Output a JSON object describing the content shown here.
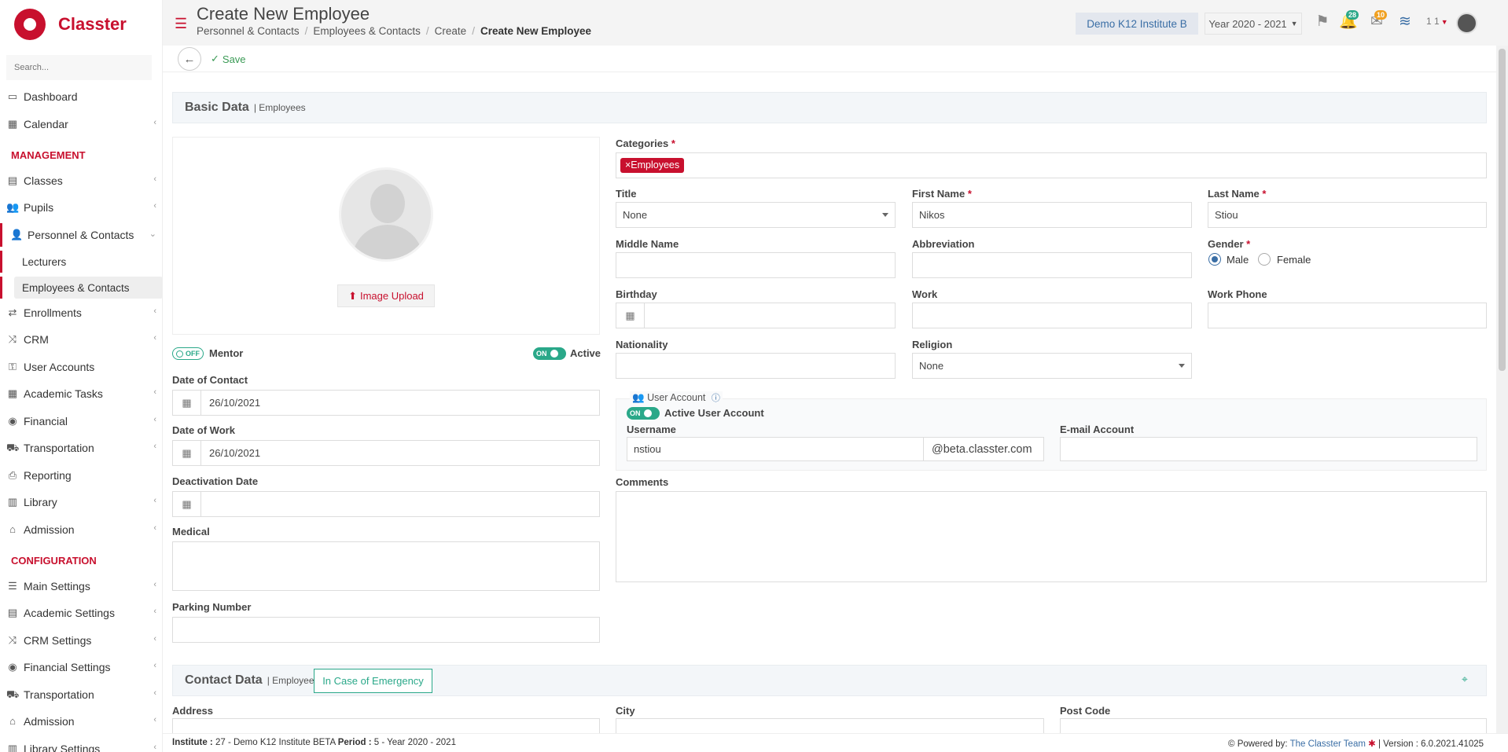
{
  "app": {
    "brand": "Classter",
    "brand_color": "#c8102e"
  },
  "sidebar": {
    "search_placeholder": "Search...",
    "items": [
      {
        "label": "Dashboard",
        "icon": "laptop-icon"
      },
      {
        "label": "Calendar",
        "icon": "calendar-icon"
      },
      {
        "label": "Classes",
        "icon": "classes-icon"
      },
      {
        "label": "Pupils",
        "icon": "pupils-icon"
      },
      {
        "label": "Personnel & Contacts",
        "icon": "person-icon"
      },
      {
        "label": "Enrollments",
        "icon": "exchange-icon"
      },
      {
        "label": "CRM",
        "icon": "shuffle-icon"
      },
      {
        "label": "User Accounts",
        "icon": "key-icon"
      },
      {
        "label": "Academic Tasks",
        "icon": "grid-icon"
      },
      {
        "label": "Financial",
        "icon": "coins-icon"
      },
      {
        "label": "Transportation",
        "icon": "bus-icon"
      },
      {
        "label": "Reporting",
        "icon": "printer-icon"
      },
      {
        "label": "Library",
        "icon": "books-icon"
      },
      {
        "label": "Admission",
        "icon": "bank-icon"
      },
      {
        "label": "Main Settings",
        "icon": "sliders-icon"
      },
      {
        "label": "Academic Settings",
        "icon": "classes-icon"
      },
      {
        "label": "CRM Settings",
        "icon": "shuffle-icon"
      },
      {
        "label": "Financial Settings",
        "icon": "coins-icon"
      },
      {
        "label": "Transportation",
        "icon": "bus-icon"
      },
      {
        "label": "Admission",
        "icon": "bank-icon"
      },
      {
        "label": "Library Settings",
        "icon": "books-icon"
      }
    ],
    "headings": {
      "management": "MANAGEMENT",
      "configuration": "CONFIGURATION"
    },
    "sub_items": [
      {
        "label": "Lecturers"
      },
      {
        "label": "Employees & Contacts"
      }
    ]
  },
  "header": {
    "title": "Create New Employee",
    "breadcrumb": [
      "Personnel & Contacts",
      "Employees & Contacts",
      "Create",
      "Create New Employee"
    ],
    "institute": "Demo K12 Institute B",
    "year": "Year 2020 - 2021",
    "notif_count": "28",
    "mail_count": "10",
    "user_label": "1 1"
  },
  "toolbar": {
    "save_label": "Save"
  },
  "basic": {
    "title": "Basic Data",
    "subtitle": "| Employees",
    "image_upload": "Image Upload",
    "mentor_toggle": "OFF",
    "mentor_label": "Mentor",
    "active_toggle": "ON",
    "active_label": "Active",
    "date_of_contact_label": "Date of Contact",
    "date_of_contact": "26/10/2021",
    "date_of_work_label": "Date of Work",
    "date_of_work": "26/10/2021",
    "deactivation_label": "Deactivation Date",
    "medical_label": "Medical",
    "parking_label": "Parking Number",
    "categories_label": "Categories",
    "category_tag": "×Employees",
    "title_label": "Title",
    "title_value": "None",
    "first_name_label": "First Name",
    "first_name": "Nikos",
    "last_name_label": "Last Name",
    "last_name": "Stiou",
    "middle_name_label": "Middle Name",
    "abbreviation_label": "Abbreviation",
    "gender_label": "Gender",
    "gender_male": "Male",
    "gender_female": "Female",
    "birthday_label": "Birthday",
    "work_label": "Work",
    "work_phone_label": "Work Phone",
    "nationality_label": "Nationality",
    "religion_label": "Religion",
    "religion_value": "None",
    "user_account_label": "User Account",
    "active_ua_toggle": "ON",
    "active_ua_label": "Active User Account",
    "username_label": "Username",
    "username": "nstiou",
    "domain": "@beta.classter.com",
    "email_label": "E-mail Account",
    "comments_label": "Comments",
    "required_mark": "*"
  },
  "contact": {
    "title": "Contact Data",
    "subtitle": "| Employees",
    "emergency_tab": "In Case of Emergency",
    "address_label": "Address",
    "city_label": "City",
    "postcode_label": "Post Code"
  },
  "footer": {
    "institute_key": "Institute :",
    "institute_val": "27 - Demo K12 Institute BETA",
    "period_key": "Period :",
    "period_val": "5 - Year 2020 - 2021",
    "powered": "Powered by:",
    "powered_link": "The Classter Team",
    "version": "| Version : 6.0.2021.41025"
  }
}
